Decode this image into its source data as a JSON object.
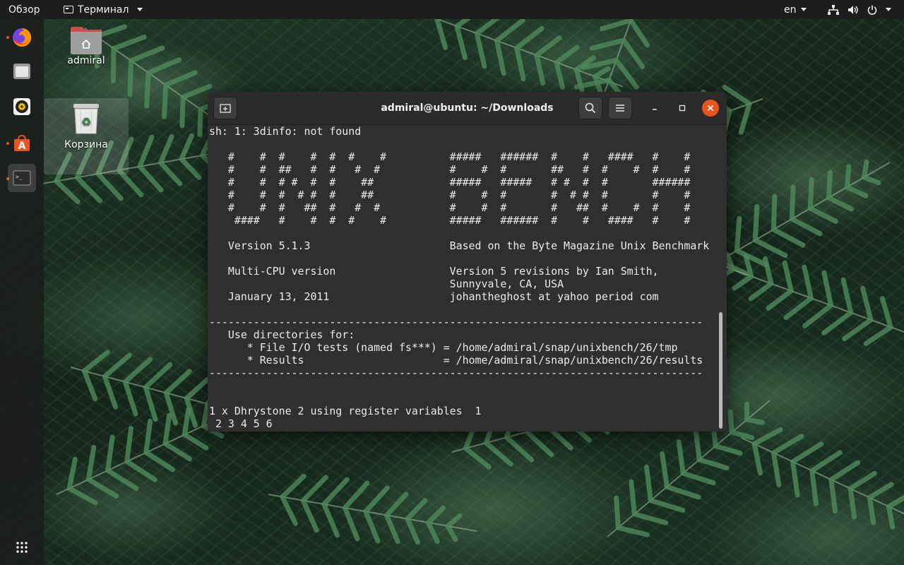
{
  "topbar": {
    "activities": "Обзор",
    "app_name": "Терминал",
    "language": "en",
    "icons": [
      "network-icon",
      "volume-icon",
      "power-icon",
      "system-menu-caret-icon"
    ]
  },
  "dock": {
    "items": [
      {
        "name": "firefox",
        "icon": "firefox-icon",
        "running": true
      },
      {
        "name": "files",
        "icon": "files-icon",
        "running": false
      },
      {
        "name": "rhythmbox",
        "icon": "rhythmbox-icon",
        "running": false
      },
      {
        "name": "ubuntu-software",
        "icon": "software-center-icon",
        "running": true
      },
      {
        "name": "terminal",
        "icon": "terminal-icon",
        "running": true,
        "active": true
      }
    ],
    "show_apps_icon": "app-grid-icon"
  },
  "desktop": {
    "home_label": "admiral",
    "trash_label": "Корзина"
  },
  "terminal": {
    "title": "admiral@ubuntu: ~/Downloads",
    "lines": [
      "sh: 1: 3dinfo: not found",
      "",
      "   #    #  #    #  #  #    #          #####   ######  #    #   ####   #    #",
      "   #    #  ##   #  #   #  #           #    #  #       ##   #  #    #  #    #",
      "   #    #  # #  #  #    ##            #####   #####   # #  #  #       ######",
      "   #    #  #  # #  #    ##            #    #  #       #  # #  #       #    #",
      "   #    #  #   ##  #   #  #           #    #  #       #   ##  #    #  #    #",
      "    ####   #    #  #  #    #          #####   ######  #    #   ####   #    #",
      "",
      "   Version 5.1.3                      Based on the Byte Magazine Unix Benchmark",
      "",
      "   Multi-CPU version                  Version 5 revisions by Ian Smith,",
      "                                      Sunnyvale, CA, USA",
      "   January 13, 2011                   johantheghost at yahoo period com",
      "",
      "------------------------------------------------------------------------------",
      "   Use directories for:",
      "      * File I/O tests (named fs***) = /home/admiral/snap/unixbench/26/tmp",
      "      * Results                      = /home/admiral/snap/unixbench/26/results",
      "------------------------------------------------------------------------------",
      "",
      "",
      "1 x Dhrystone 2 using register variables  1",
      " 2 3 4 5 6"
    ]
  },
  "colors": {
    "accent": "#e95420",
    "terminal_bg": "#2f2f2f",
    "topbar_bg": "#1d1d1d"
  }
}
